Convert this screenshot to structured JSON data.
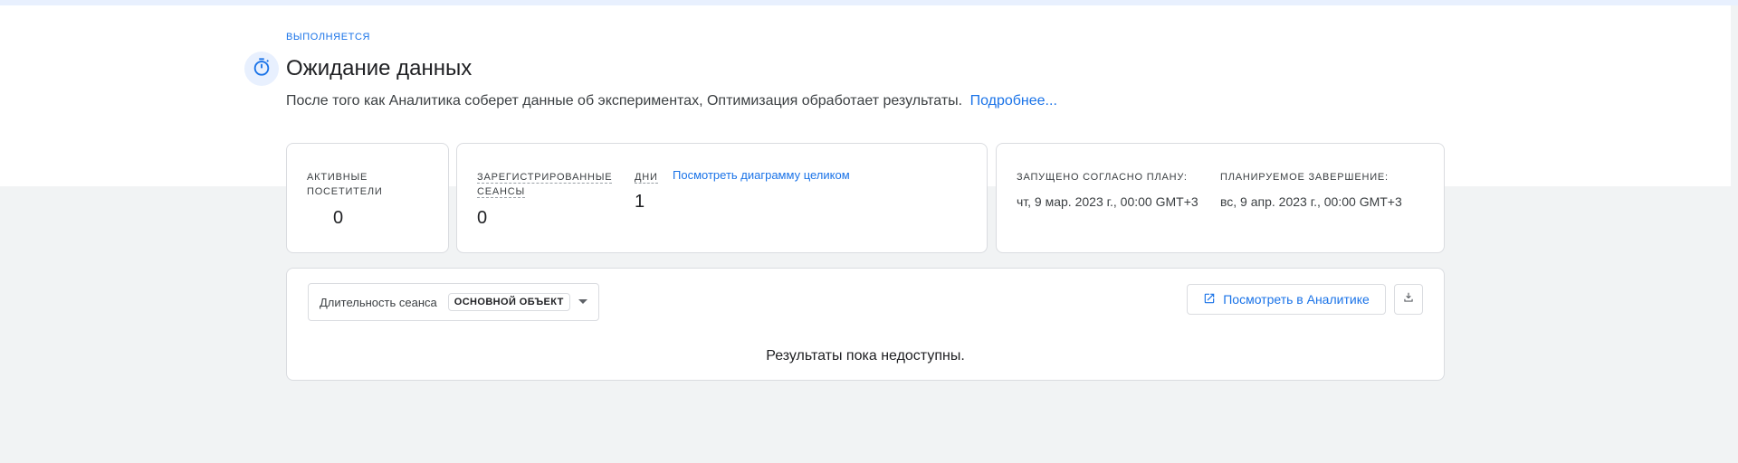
{
  "status": {
    "label": "ВЫПОЛНЯЕТСЯ"
  },
  "header": {
    "title": "Ожидание данных",
    "description": "После того как Аналитика соберет данные об экспериментах, Оптимизация обработает результаты.",
    "more_link": "Подробнее..."
  },
  "metrics": {
    "active_visitors": {
      "label_line1": "АКТИВНЫЕ",
      "label_line2": "ПОСЕТИТЕЛИ",
      "value": "0"
    },
    "sessions": {
      "label_line1": "ЗАРЕГИСТРИРОВАННЫЕ",
      "label_line2": "СЕАНСЫ",
      "value": "0"
    },
    "days": {
      "label": "ДНИ",
      "value": "1",
      "link": "Посмотреть диаграмму целиком"
    },
    "schedule": {
      "started_label": "ЗАПУЩЕНО СОГЛАСНО ПЛАНУ:",
      "started_value": "чт, 9 мар. 2023 г., 00:00 GMT+3",
      "end_label": "ПЛАНИРУЕМОЕ ЗАВЕРШЕНИЕ:",
      "end_value": "вс, 9 апр. 2023 г., 00:00 GMT+3"
    }
  },
  "results": {
    "metric_select": {
      "label": "Длительность сеанса",
      "chip": "ОСНОВНОЙ ОБЪЕКТ"
    },
    "view_in_analytics": "Посмотреть в Аналитике",
    "empty_message": "Результаты пока недоступны."
  },
  "icons": {
    "timer": "timer-icon",
    "open_in_new": "open-in-new-icon",
    "download": "download-icon",
    "dropdown": "chevron-down-icon"
  },
  "colors": {
    "accent": "#1a73e8",
    "page_bg": "#f1f3f4",
    "card_border": "#dadce0"
  }
}
